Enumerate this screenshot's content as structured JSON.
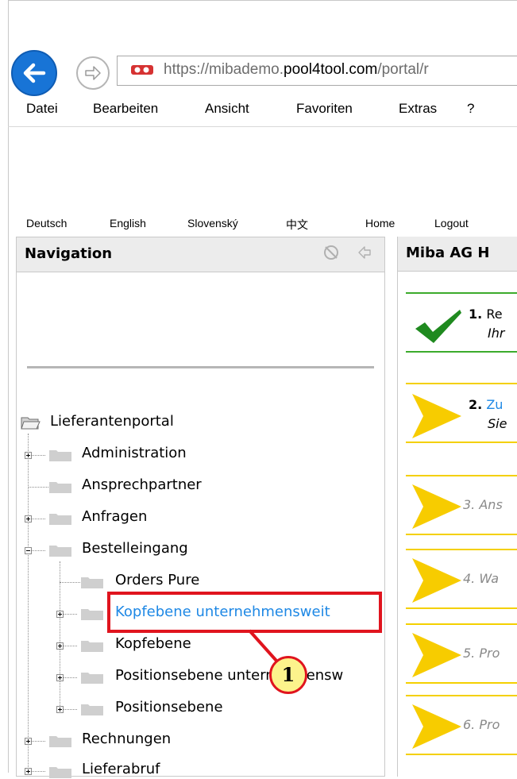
{
  "browser": {
    "url_scheme": "https://",
    "url_subdomain": "mibademo.",
    "url_domain": "pool4tool.com",
    "url_path": "/portal/r",
    "menu": [
      "Datei",
      "Bearbeiten",
      "Ansicht",
      "Favoriten",
      "Extras",
      "?"
    ]
  },
  "topbar": {
    "languages": [
      "Deutsch",
      "English",
      "Slovenský",
      "中文"
    ],
    "links": [
      "Home",
      "Logout"
    ]
  },
  "navigation": {
    "title": "Navigation",
    "root": "Lieferantenportal",
    "items": [
      {
        "label": "Administration",
        "state": "collapsed"
      },
      {
        "label": "Ansprechpartner",
        "state": "leaf"
      },
      {
        "label": "Anfragen",
        "state": "collapsed"
      },
      {
        "label": "Bestelleingang",
        "state": "expanded"
      },
      {
        "label": "Orders Pure",
        "state": "leaf"
      },
      {
        "label": "Kopfebene unternehmensweit",
        "state": "collapsed",
        "selected": true
      },
      {
        "label": "Kopfebene",
        "state": "collapsed"
      },
      {
        "label": "Positionsebene unternehmensw",
        "state": "collapsed"
      },
      {
        "label": "Positionsebene",
        "state": "collapsed"
      },
      {
        "label": "Rechnungen",
        "state": "collapsed"
      },
      {
        "label": "Lieferabruf",
        "state": "collapsed"
      }
    ]
  },
  "main": {
    "title": "Miba AG H",
    "steps": [
      {
        "number": "1.",
        "text": "Re",
        "subtext": "Ihr",
        "status": "done"
      },
      {
        "number": "2.",
        "text": "Zu",
        "subtext": "Sie",
        "status": "active"
      },
      {
        "number": "3.",
        "text": "Ans",
        "status": "pending"
      },
      {
        "number": "4.",
        "text": "Wa",
        "status": "pending"
      },
      {
        "number": "5.",
        "text": "Pro",
        "status": "pending"
      },
      {
        "number": "6.",
        "text": "Pro",
        "status": "pending"
      }
    ]
  },
  "annotation": {
    "callout": "1"
  },
  "colors": {
    "link": "#1e88e5",
    "highlight": "#e0141e",
    "done_line": "#3cab2c",
    "step_line": "#f4d000",
    "back_button": "#1874d6"
  },
  "icons": [
    "back-arrow-icon",
    "forward-arrow-icon",
    "site-security-icon",
    "refresh-icon",
    "collapse-arrow-icon",
    "folder-icon",
    "checkmark-icon",
    "step-arrow-icon"
  ]
}
